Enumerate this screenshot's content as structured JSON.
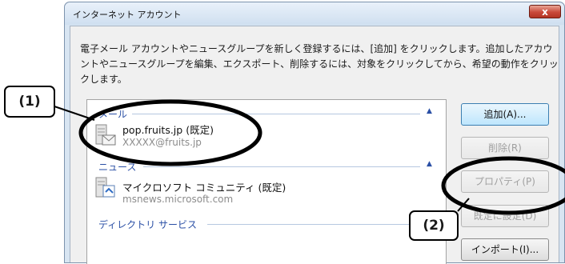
{
  "dialog": {
    "title": "インターネット アカウント",
    "close_label": "x",
    "description": "電子メール アカウントやニュースグループを新しく登録するには、[追加] をクリックします。追加したアカウントやニュースグループを編集、エクスポート、削除するには、対象をクリックしてから、希望の動作をクリックします。"
  },
  "accounts": {
    "mail_group": "メール",
    "mail_item": {
      "name": "pop.fruits.jp (既定)",
      "address": "XXXXX@fruits.jp"
    },
    "news_group": "ニュース",
    "news_item": {
      "name": "マイクロソフト コミュニティ (既定)",
      "server": "msnews.microsoft.com"
    },
    "directory_group": "ディレクトリ サービス"
  },
  "buttons": {
    "add": "追加(A)...",
    "delete": "削除(R)",
    "properties": "プロパティ(P)",
    "set_default": "既定に設定(D)",
    "import": "インポート(I)..."
  },
  "annotations": {
    "callout1": "(1)",
    "callout2": "(2)"
  }
}
